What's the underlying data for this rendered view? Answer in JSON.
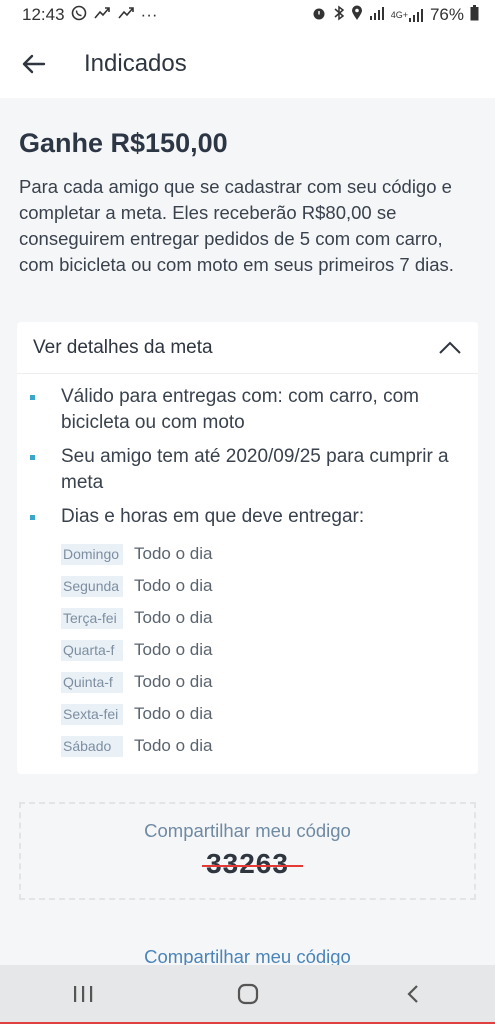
{
  "status_bar": {
    "time": "12:43",
    "left_icons": [
      "whatsapp-icon",
      "missed-call-icon",
      "missed-call-icon",
      "more-dots-icon"
    ],
    "more": "···",
    "right_icons": [
      "alarm-icon",
      "bluetooth-icon",
      "location-icon",
      "signal-icon",
      "4g-signal-icon",
      "battery-icon"
    ],
    "network": "4G+",
    "battery": "76%"
  },
  "app_bar": {
    "title": "Indicados"
  },
  "content": {
    "headline": "Ganhe R$150,00",
    "description": "Para cada amigo que se cadastrar com seu código e completar a meta. Eles receberão R$80,00 se conseguirem entregar pedidos de 5 com com carro, com bicicleta ou com moto em seus primeiros 7 dias."
  },
  "details": {
    "header_label": "Ver detalhes da meta",
    "bullets": [
      "Válido para entregas com: com carro, com bicicleta ou com moto",
      "Seu amigo tem até 2020/09/25 para cumprir a meta",
      "Dias e horas em que deve entregar:"
    ],
    "schedule": [
      {
        "day": "Domingo",
        "hours": "Todo o dia"
      },
      {
        "day": "Segunda",
        "hours": "Todo o dia"
      },
      {
        "day": "Terça-fei",
        "hours": "Todo o dia"
      },
      {
        "day": "Quarta-f",
        "hours": "Todo o dia"
      },
      {
        "day": "Quinta-f",
        "hours": "Todo o dia"
      },
      {
        "day": "Sexta-fei",
        "hours": "Todo o dia"
      },
      {
        "day": "Sábado",
        "hours": "Todo o dia"
      }
    ]
  },
  "share": {
    "label": "Compartilhar meu código",
    "code": "33263",
    "link_label": "Compartilhar meu código"
  },
  "colors": {
    "accent": "#3aa6c9",
    "link": "#4a84b8",
    "strike": "#e53935"
  }
}
